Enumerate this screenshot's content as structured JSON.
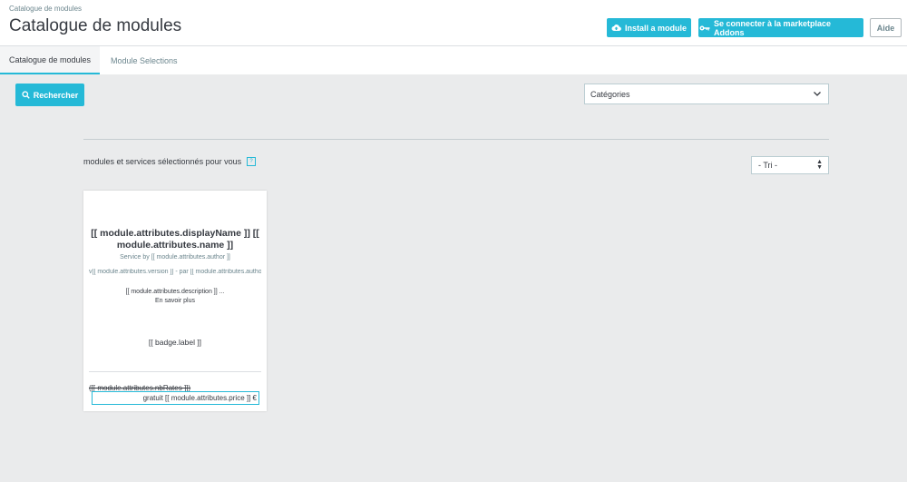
{
  "header": {
    "breadcrumb": "Catalogue de modules",
    "title": "Catalogue de modules",
    "install_label": "Install a module",
    "connect_label": "Se connecter à la marketplace Addons",
    "help_label": "Aide"
  },
  "tabs": [
    {
      "label": "Catalogue de modules",
      "active": true
    },
    {
      "label": "Module Selections",
      "active": false
    }
  ],
  "toolbar": {
    "search_label": "Rechercher",
    "category_value": "Catégories",
    "sort_value": "- Tri -"
  },
  "section": {
    "text": "modules et services sélectionnés pour vous",
    "help": "?"
  },
  "card": {
    "title": "[[ module.attributes.displayName ]] [[ module.attributes.name ]]",
    "author": "Service by [[ module.attributes.author ]]",
    "version": "v[[ module.attributes.version ]] - par [[ module.attributes.author ]]",
    "description": "[[ module.attributes.description ]] ...",
    "more": "En savoir plus",
    "badge": "[[ badge.label ]]",
    "rates": "([[ module.attributes.nbRates ]])",
    "price": "gratuit [[ module.attributes.price ]] €"
  },
  "colors": {
    "accent": "#25b9d7",
    "background": "#eaebec"
  }
}
